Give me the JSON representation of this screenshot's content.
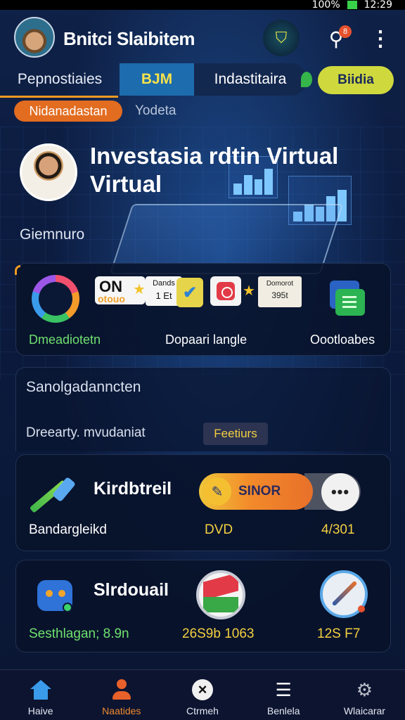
{
  "status_bar": {
    "battery": "100%",
    "time": "12:29"
  },
  "header": {
    "title": "Bnitci Slaibitem",
    "notification_count": "8"
  },
  "tabs": [
    {
      "label": "Pepnostiaies"
    },
    {
      "label": "BJM"
    },
    {
      "label": "Indastitaira"
    },
    {
      "label": "Biidia"
    }
  ],
  "chips": {
    "active": "Nidanadastan",
    "inactive": "Yodeta"
  },
  "hero": {
    "title": "Investasia rdtin Virtual Virtual",
    "subtitle": "Giemnuro"
  },
  "features": {
    "on_badge": "ON",
    "on_badge_sub": "otouo",
    "deals_badge_title": "Dands",
    "deals_badge_value": "1 Et",
    "price_badge_title": "Domorot",
    "price_badge_value": "395t",
    "items": [
      {
        "label": "Dmeadiotetn"
      },
      {
        "label": "Dopaari langle"
      },
      {
        "label": "Oootloabes"
      }
    ]
  },
  "search_card": {
    "title": "Sanolgadanncten",
    "subtitle": "Dreearty. mvudaniat",
    "feature_tag": "Feetiurs"
  },
  "item_card_1": {
    "title": "Kirdbtreil",
    "subtitle": "Bandargleikd",
    "toggle_label": "SINOR",
    "meta_1": "DVD",
    "meta_2": "4/301"
  },
  "item_card_2": {
    "title": "Slrdouail",
    "subtitle": "Sesthlagan; 8.9n",
    "meta_1": "26S9b 1063",
    "meta_2": "12S F7"
  },
  "bottom_nav": [
    {
      "label": "Haive"
    },
    {
      "label": "Naatides"
    },
    {
      "label": "Ctrmeh"
    },
    {
      "label": "Benlela"
    },
    {
      "label": "Wlaicarar"
    }
  ],
  "colors": {
    "accent_orange": "#f29a22",
    "accent_blue": "#1d6cad",
    "accent_yellow": "#f4d040",
    "accent_green": "#6fe06e"
  }
}
